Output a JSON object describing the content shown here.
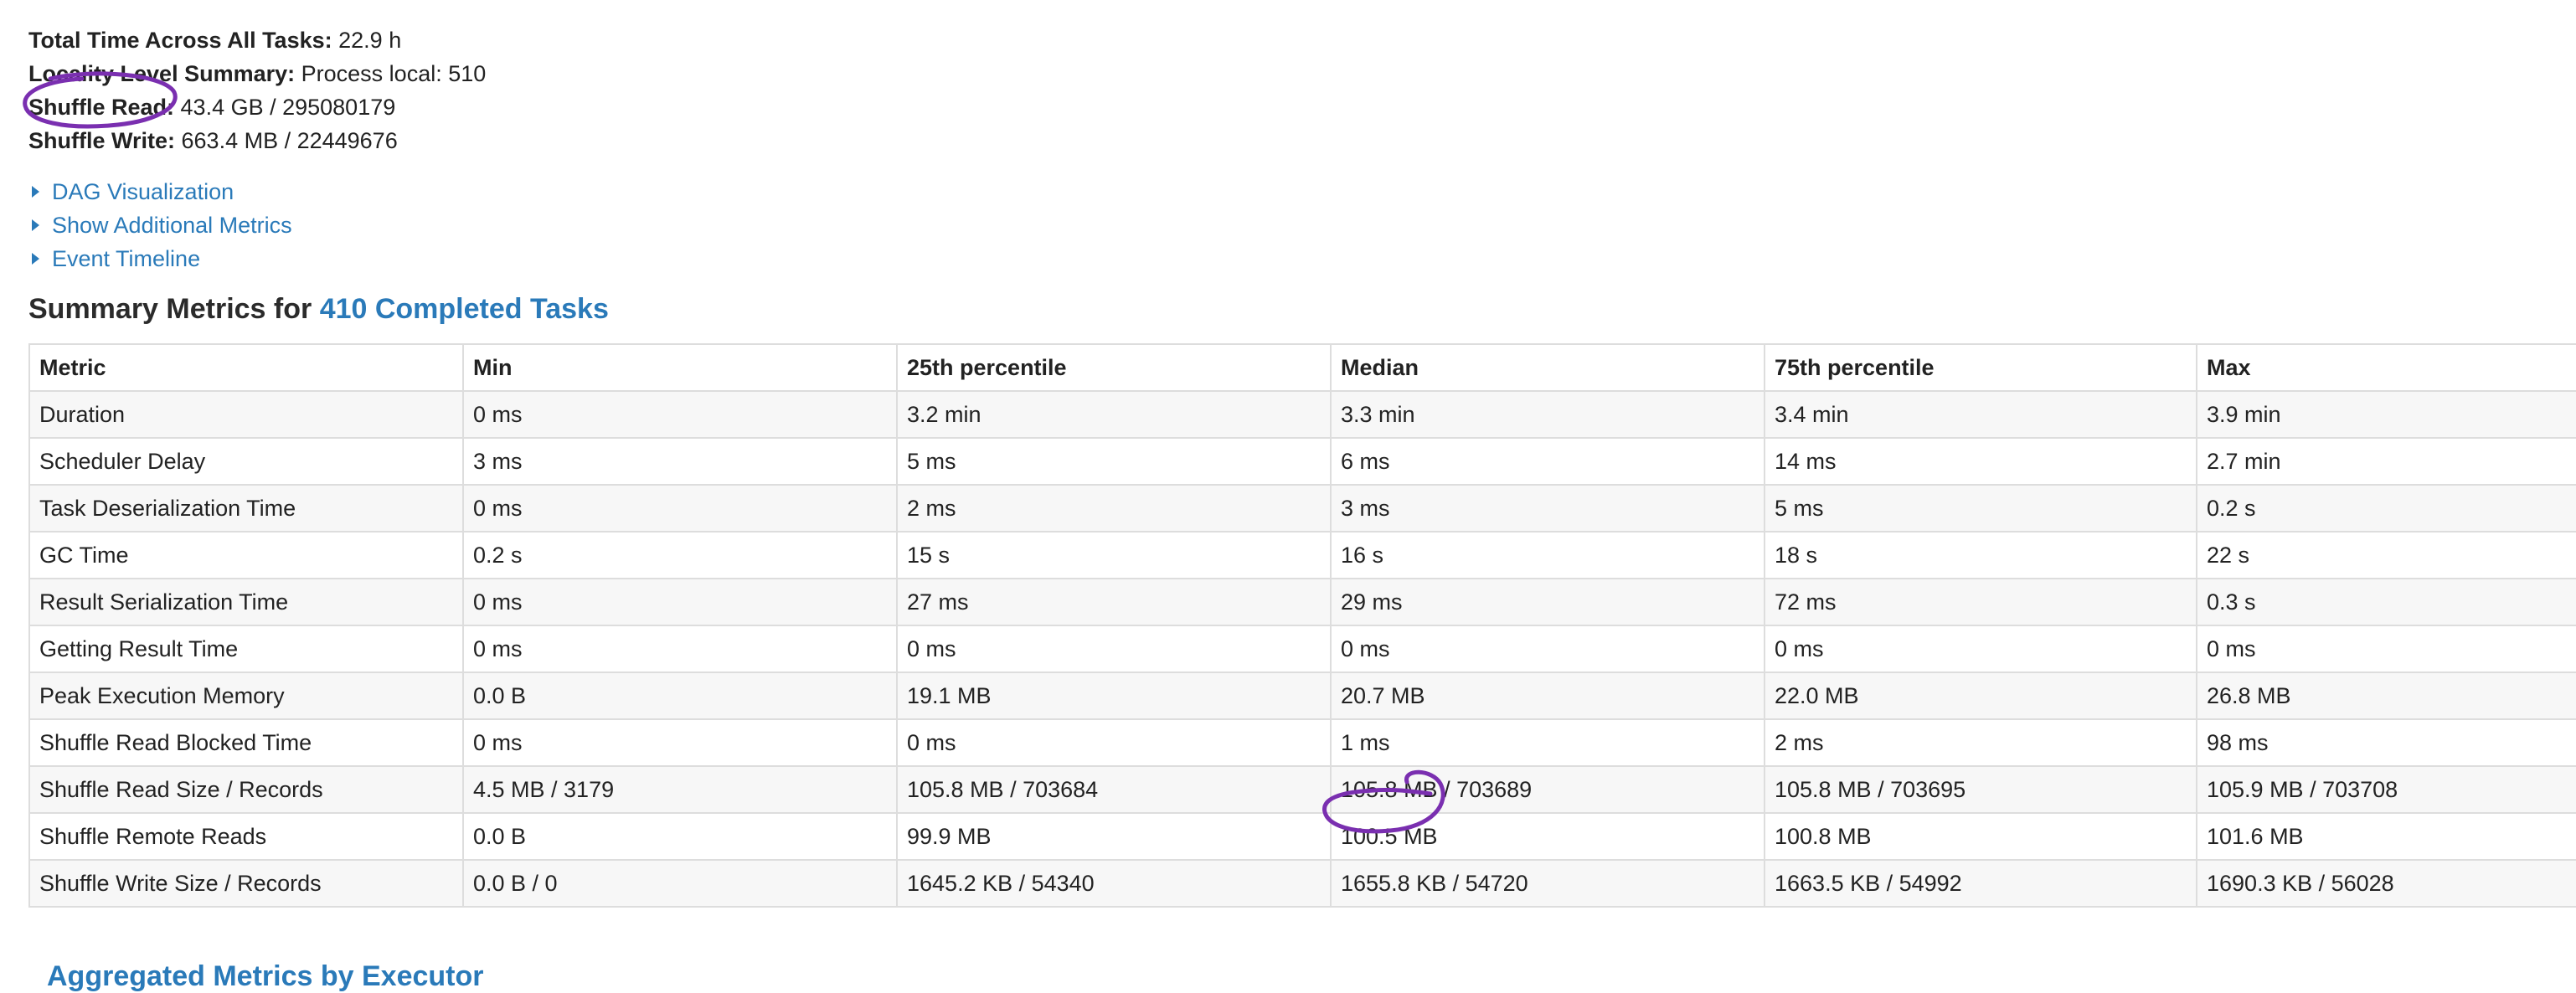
{
  "summary": {
    "total_time": {
      "label": "Total Time Across All Tasks:",
      "value": "22.9 h"
    },
    "locality": {
      "label": "Locality Level Summary:",
      "value": "Process local: 510"
    },
    "shuffle_read": {
      "label": "Shuffle Read:",
      "value": "43.4 GB / 295080179"
    },
    "shuffle_write": {
      "label": "Shuffle Write:",
      "value": "663.4 MB / 22449676"
    }
  },
  "links": {
    "dag": "DAG Visualization",
    "additional_metrics": "Show Additional Metrics",
    "event_timeline": "Event Timeline"
  },
  "section": {
    "title_prefix": "Summary Metrics for",
    "title_link": "410 Completed Tasks"
  },
  "table": {
    "headers": [
      "Metric",
      "Min",
      "25th percentile",
      "Median",
      "75th percentile",
      "Max"
    ],
    "rows": [
      [
        "Duration",
        "0 ms",
        "3.2 min",
        "3.3 min",
        "3.4 min",
        "3.9 min"
      ],
      [
        "Scheduler Delay",
        "3 ms",
        "5 ms",
        "6 ms",
        "14 ms",
        "2.7 min"
      ],
      [
        "Task Deserialization Time",
        "0 ms",
        "2 ms",
        "3 ms",
        "5 ms",
        "0.2 s"
      ],
      [
        "GC Time",
        "0.2 s",
        "15 s",
        "16 s",
        "18 s",
        "22 s"
      ],
      [
        "Result Serialization Time",
        "0 ms",
        "27 ms",
        "29 ms",
        "72 ms",
        "0.3 s"
      ],
      [
        "Getting Result Time",
        "0 ms",
        "0 ms",
        "0 ms",
        "0 ms",
        "0 ms"
      ],
      [
        "Peak Execution Memory",
        "0.0 B",
        "19.1 MB",
        "20.7 MB",
        "22.0 MB",
        "26.8 MB"
      ],
      [
        "Shuffle Read Blocked Time",
        "0 ms",
        "0 ms",
        "1 ms",
        "2 ms",
        "98 ms"
      ],
      [
        "Shuffle Read Size / Records",
        "4.5 MB / 3179",
        "105.8 MB / 703684",
        "105.8 MB / 703689",
        "105.8 MB / 703695",
        "105.9 MB / 703708"
      ],
      [
        "Shuffle Remote Reads",
        "0.0 B",
        "99.9 MB",
        "100.5 MB",
        "100.8 MB",
        "101.6 MB"
      ],
      [
        "Shuffle Write Size / Records",
        "0.0 B / 0",
        "1645.2 KB / 54340",
        "1655.8 KB / 54720",
        "1663.5 KB / 54992",
        "1690.3 KB / 56028"
      ]
    ]
  },
  "bottom_link": "Aggregated Metrics by Executor",
  "colors": {
    "link": "#2a7ab9",
    "annotation": "#7a2fb0",
    "row_stripe": "#f7f7f7",
    "border": "#dddddd"
  },
  "icons": {
    "collapse_caret": "caret-right-icon"
  }
}
